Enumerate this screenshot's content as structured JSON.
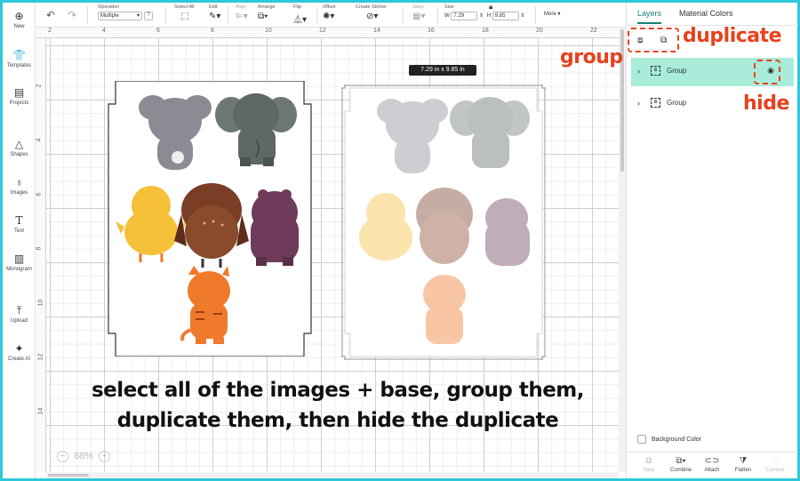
{
  "rail": {
    "items": [
      {
        "label": "New",
        "icon": "plus-circle-icon"
      },
      {
        "label": "Templates",
        "icon": "shirt-icon"
      },
      {
        "label": "Projects",
        "icon": "clipboard-icon"
      },
      {
        "label": "Shapes",
        "icon": "shapes-icon"
      },
      {
        "label": "Images",
        "icon": "lightbulb-icon"
      },
      {
        "label": "Text",
        "icon": "text-icon"
      },
      {
        "label": "Monogram",
        "icon": "monogram-icon"
      },
      {
        "label": "Upload",
        "icon": "upload-icon"
      },
      {
        "label": "Create AI",
        "icon": "sparkle-icon"
      }
    ]
  },
  "toolbar": {
    "operation_label": "Operation",
    "operation_value": "Multiple",
    "help": "?",
    "select_all_label": "Select All",
    "edit_label": "Edit",
    "align_label": "Align",
    "arrange_label": "Arrange",
    "flip_label": "Flip",
    "offset_label": "Offset",
    "create_sticker_label": "Create Sticker",
    "warp_label": "Warp",
    "size_label": "Size",
    "w_label": "W",
    "w_value": "7.29",
    "h_label": "H",
    "h_value": "9.85",
    "more_label": "More"
  },
  "ruler": {
    "top": [
      "2",
      "4",
      "6",
      "8",
      "10",
      "12",
      "14",
      "16",
      "18",
      "20",
      "22"
    ],
    "left": [
      "2",
      "4",
      "6",
      "8",
      "10",
      "12",
      "14"
    ]
  },
  "canvas": {
    "dimension_label": "7.29  in x 9.85  in",
    "zoom_value": "68%",
    "zoom_out": "−",
    "zoom_in": "+"
  },
  "caption": {
    "line1": "select all of the images + base, group them,",
    "line2": "duplicate them, then hide the duplicate"
  },
  "panel": {
    "tabs": [
      "Layers",
      "Material Colors"
    ],
    "layers": [
      {
        "name": "Group",
        "selected": true
      },
      {
        "name": "Group",
        "selected": false
      }
    ],
    "background_color_label": "Background Color",
    "bottom_tools": [
      "Slice",
      "Combine",
      "Attach",
      "Flatten",
      "Contour"
    ]
  },
  "annotations": {
    "group": "group",
    "duplicate": "duplicate",
    "hide": "hide",
    "color": "#e8411c"
  },
  "colors": {
    "accent": "#1a7f7a",
    "selected_layer": "#a8ecd9",
    "frame": "#2ec8d8"
  }
}
